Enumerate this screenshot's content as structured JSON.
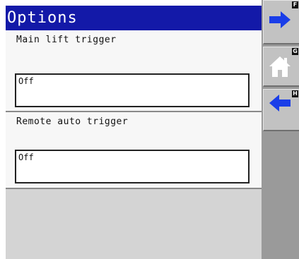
{
  "title": "Options",
  "sections": [
    {
      "label": "Main lift trigger",
      "value": "Off"
    },
    {
      "label": "Remote auto trigger",
      "value": "Off"
    }
  ],
  "side_buttons": [
    {
      "icon": "arrow-right-icon",
      "key": "F"
    },
    {
      "icon": "home-icon",
      "key": "G"
    },
    {
      "icon": "arrow-left-icon",
      "key": "H"
    }
  ],
  "colors": {
    "title_bar": "#1319a8",
    "arrow": "#1a3ee8",
    "panel": "#f7f7f7",
    "background": "#d4d4d4",
    "sidebar": "#9a9a9a"
  }
}
